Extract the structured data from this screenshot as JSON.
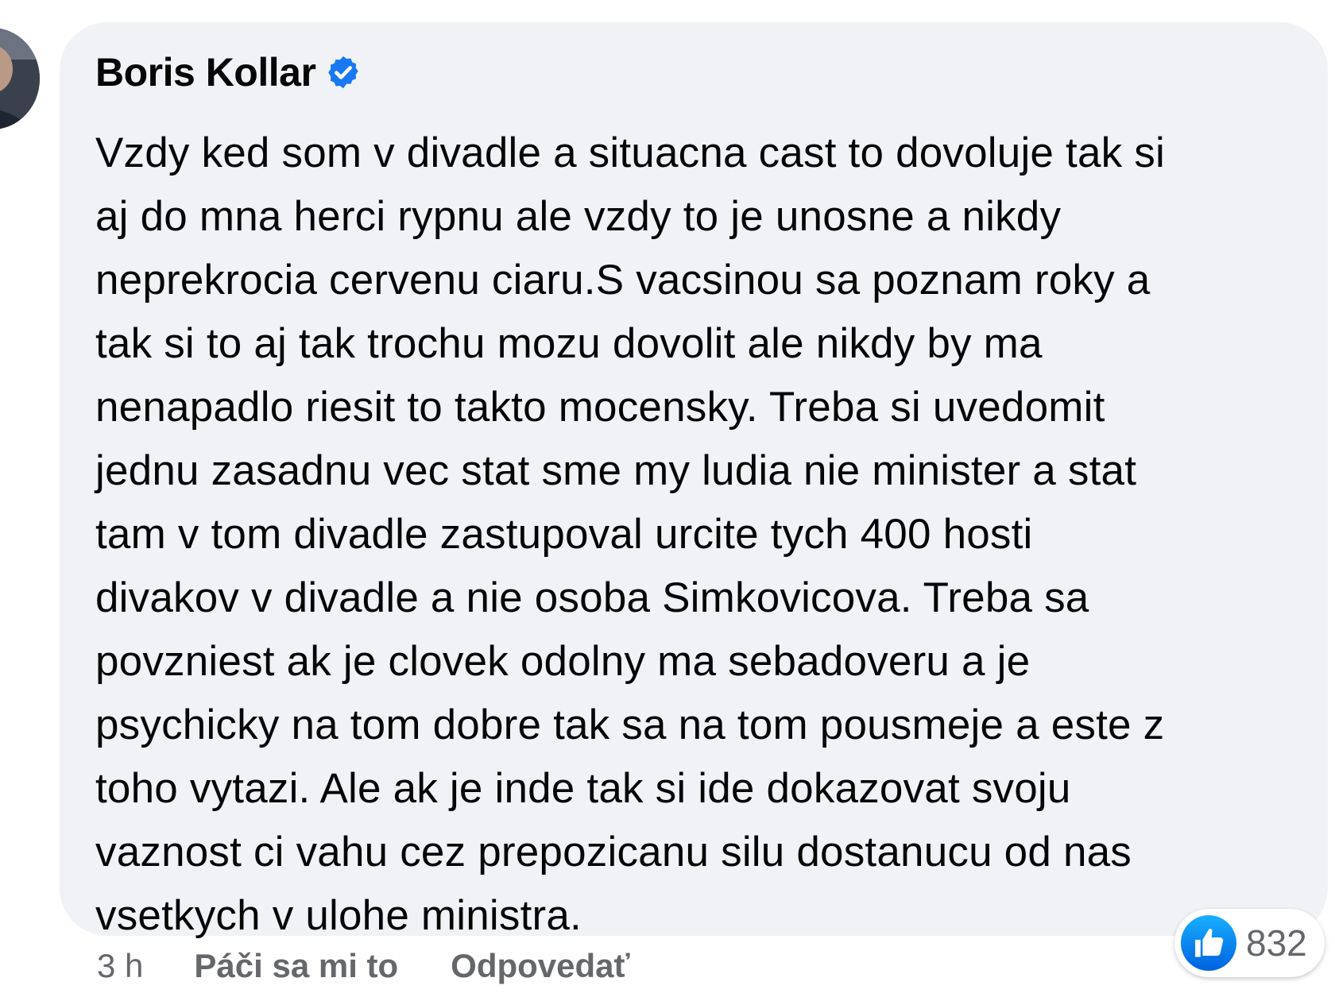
{
  "comment": {
    "author": "Boris Kollar",
    "verified": true,
    "lines": [
      "Vzdy ked som v divadle a situacna cast to dovoluje tak si",
      "aj do mna herci rypnu ale vzdy to je unosne a nikdy",
      "neprekrocia cervenu ciaru.S vacsinou sa poznam roky a",
      "tak si to aj tak trochu mozu dovolit ale nikdy by ma",
      "nenapadlo riesit to takto mocensky. Treba si uvedomit",
      "jednu zasadnu vec stat sme my ludia nie minister a stat",
      "tam v tom divadle zastupoval urcite tych 400 hosti",
      "divakov v divadle a nie osoba Simkovicova. Treba sa",
      "povzniest ak je clovek odolny ma sebadoveru a je",
      "psychicky na tom dobre tak sa na tom pousmeje a este z",
      "toho vytazi. Ale ak je inde tak si ide dokazovat svoju",
      "vaznost ci vahu cez prepozicanu silu dostanucu od nas",
      "vsetkych v ulohe ministra."
    ],
    "reaction_count": "832",
    "reaction_icon": "like-icon"
  },
  "meta": {
    "time": "3 h",
    "like_label": "Páči sa mi to",
    "reply_label": "Odpovedať"
  },
  "colors": {
    "bubble": "#f0f2f5",
    "text": "#050505",
    "secondary": "#65676b",
    "accent": "#1877f2"
  }
}
